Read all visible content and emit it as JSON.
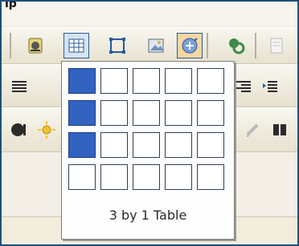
{
  "top_bar": {
    "fragment": "ip"
  },
  "table_picker": {
    "label": "3 by 1 Table",
    "rows": 4,
    "cols": 5,
    "selected_rows": 3,
    "selected_cols": 1
  },
  "toolbar": {
    "row1": [
      {
        "name": "insert-media-icon"
      },
      {
        "name": "insert-table-icon",
        "state": "pressed"
      },
      {
        "name": "insert-frame-icon"
      },
      {
        "name": "insert-image-icon"
      },
      {
        "name": "insert-plugin-icon",
        "state": "hover"
      },
      {
        "name": "link-icon"
      },
      {
        "name": "page-icon"
      }
    ],
    "row2": [
      {
        "name": "align-left-icon"
      },
      {
        "name": "bullets-icon"
      },
      {
        "name": "indent-icon"
      }
    ],
    "row3": [
      {
        "name": "play-icon"
      },
      {
        "name": "sun-icon"
      },
      {
        "name": "pencil-icon"
      },
      {
        "name": "columns-icon"
      }
    ]
  }
}
